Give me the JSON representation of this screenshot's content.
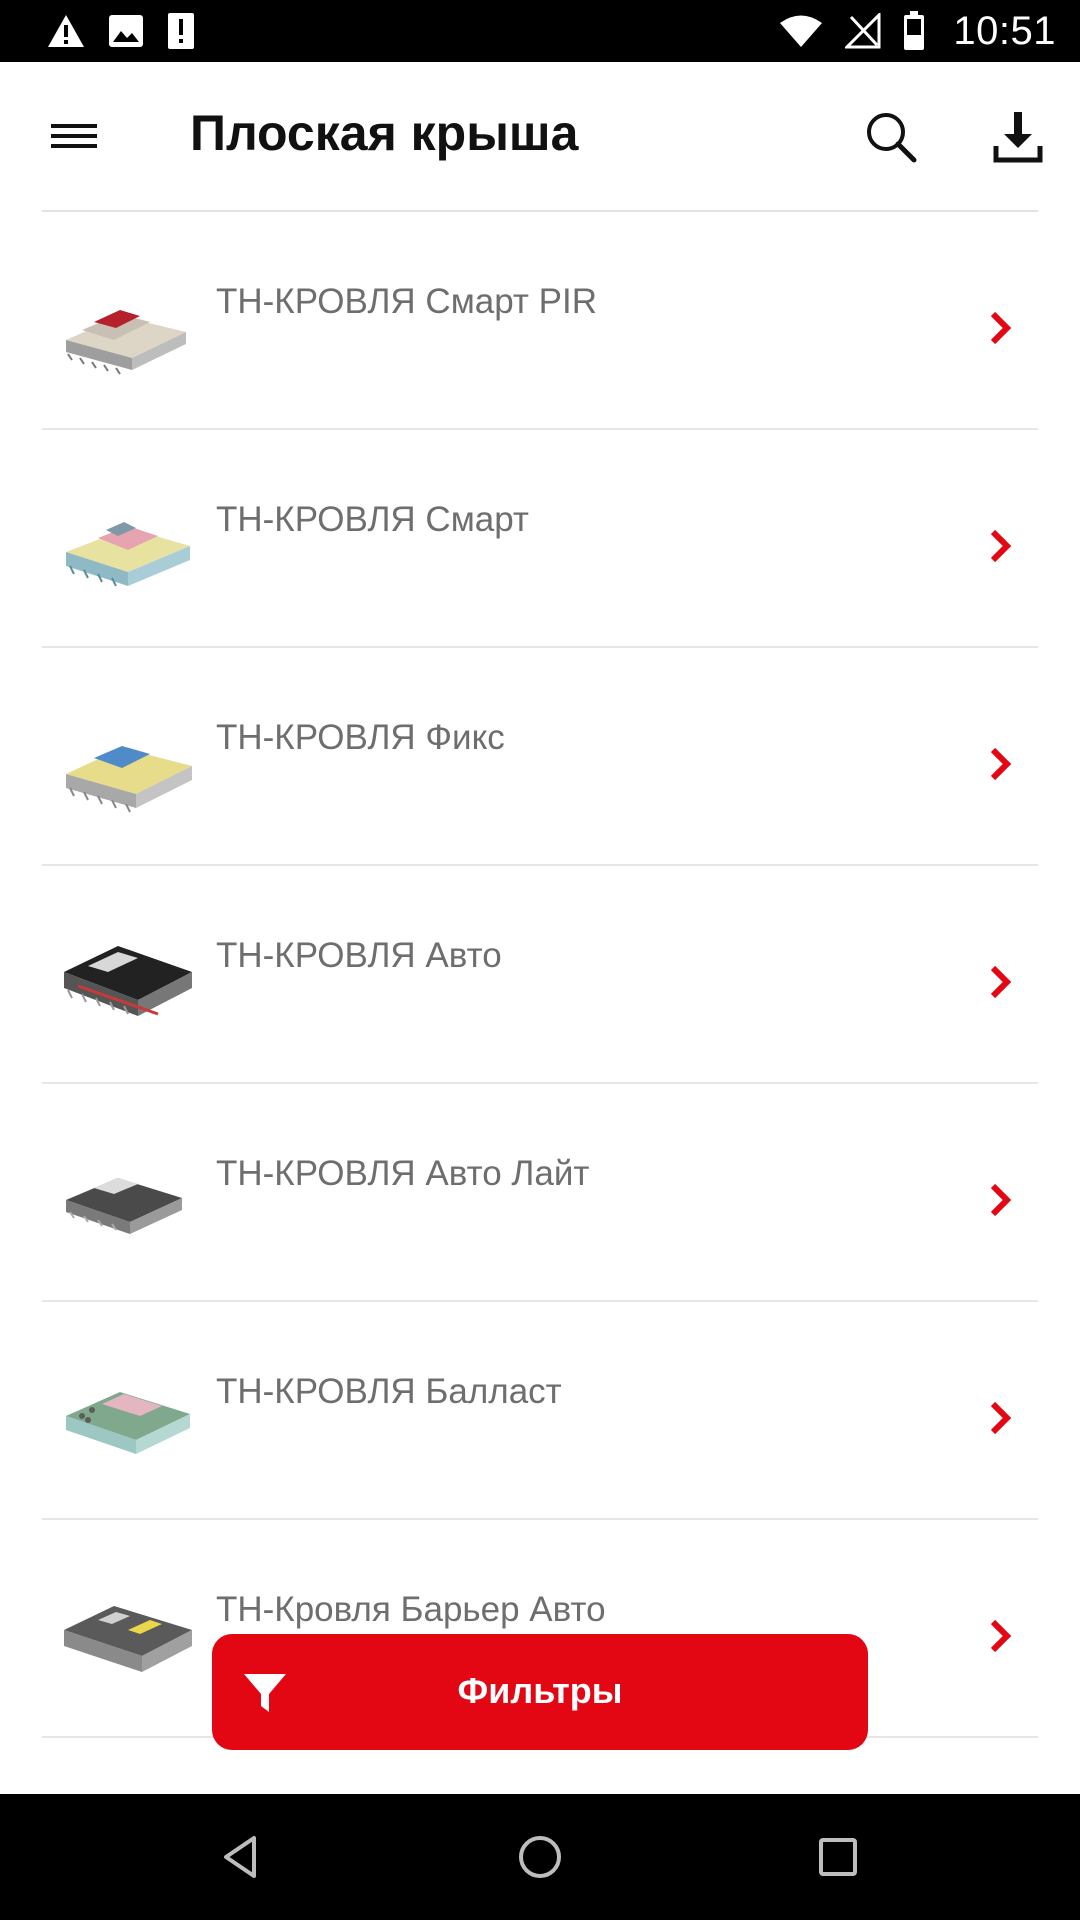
{
  "status_bar": {
    "time": "10:51",
    "icons_left": [
      "warning-icon",
      "image-icon",
      "alert-box-icon"
    ],
    "icons_right": [
      "wifi-icon",
      "no-signal-icon",
      "battery-icon"
    ]
  },
  "header": {
    "title": "Плоская крыша",
    "icons": [
      "menu-icon",
      "search-icon",
      "download-icon"
    ]
  },
  "items": [
    {
      "title": "ТН-КРОВЛЯ Смарт PIR"
    },
    {
      "title": "ТН-КРОВЛЯ Смарт"
    },
    {
      "title": "ТН-КРОВЛЯ Фикс"
    },
    {
      "title": "ТН-КРОВЛЯ Авто"
    },
    {
      "title": "ТН-КРОВЛЯ Авто Лайт"
    },
    {
      "title": "ТН-КРОВЛЯ Балласт"
    },
    {
      "title": "ТН-Кровля Барьер Авто"
    }
  ],
  "filter_button": {
    "label": "Фильтры",
    "icon": "filter-icon"
  },
  "nav_bar": {
    "icons": [
      "back-icon",
      "home-icon",
      "recents-icon"
    ]
  },
  "colors": {
    "accent": "#e30613",
    "title_text": "#111111",
    "item_text": "#6e6e6e"
  }
}
